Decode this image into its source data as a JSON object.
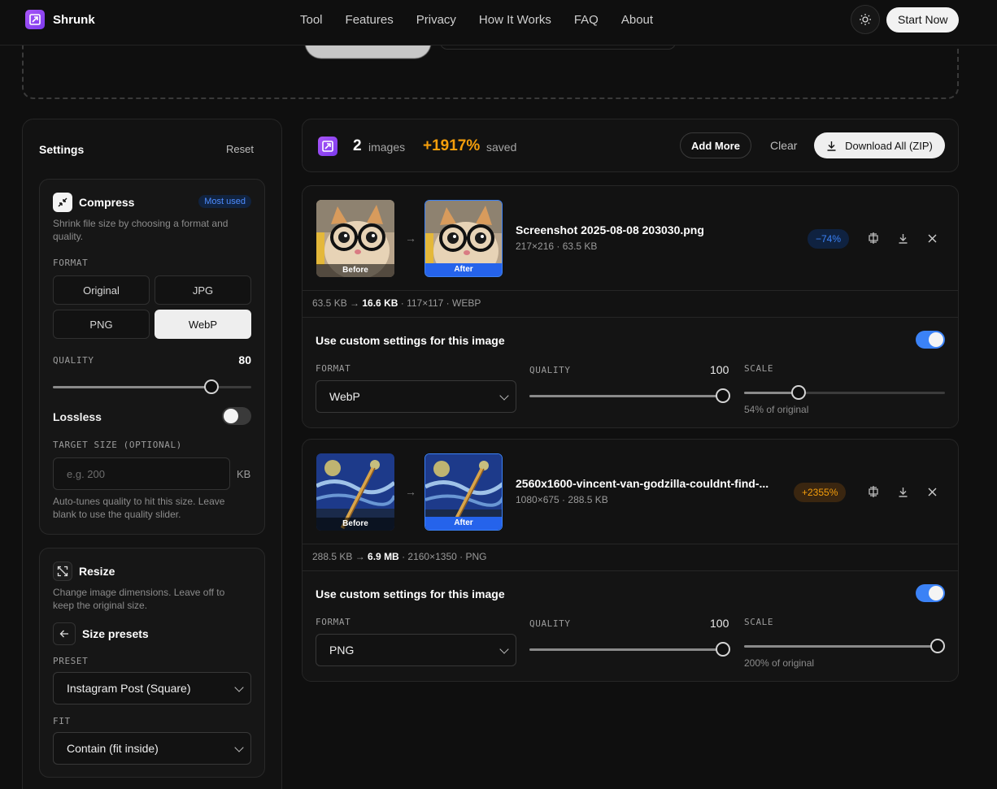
{
  "brand": {
    "name": "Shrunk"
  },
  "nav": {
    "links": [
      "Tool",
      "Features",
      "Privacy",
      "How It Works",
      "FAQ",
      "About"
    ],
    "cta": "Start Now"
  },
  "settings": {
    "title": "Settings",
    "reset": "Reset",
    "compress": {
      "title": "Compress",
      "badge": "Most used",
      "description": "Shrink file size by choosing a format and quality.",
      "format_label": "FORMAT",
      "formats": [
        "Original",
        "JPG",
        "PNG",
        "WebP"
      ],
      "selected_format": "WebP",
      "quality_label": "QUALITY",
      "quality": "80",
      "quality_fraction": 0.8,
      "lossless_label": "Lossless",
      "lossless": false,
      "target_label": "TARGET SIZE (OPTIONAL)",
      "target_placeholder": "e.g. 200",
      "target_unit": "KB",
      "target_hint": "Auto-tunes quality to hit this size. Leave blank to use the quality slider."
    },
    "resize": {
      "title": "Resize",
      "description": "Change image dimensions. Leave off to keep the original size.",
      "presets_title": "Size presets",
      "preset_label": "PRESET",
      "preset_value": "Instagram Post (Square)",
      "fit_label": "FIT",
      "fit_value": "Contain (fit inside)"
    }
  },
  "summary": {
    "count": "2",
    "count_label": "images",
    "saved": "+1917%",
    "saved_label": "saved",
    "add_more": "Add More",
    "clear": "Clear",
    "download_all": "Download All (ZIP)"
  },
  "images": [
    {
      "name": "Screenshot 2025-08-08 203030.png",
      "meta": "217×216 · 63.5 KB",
      "change": "−74%",
      "before_label": "Before",
      "after_label": "After",
      "info_from": "63.5 KB → ",
      "info_to": "16.6 KB",
      "info_rest": " · 117×117 · WEBP",
      "custom_label": "Use custom settings for this image",
      "custom_on": true,
      "format_label": "FORMAT",
      "format": "WebP",
      "quality_label": "QUALITY",
      "quality": "100",
      "quality_fraction": 1.0,
      "scale_label": "SCALE",
      "scale_note": "54% of original",
      "scale_fraction": 0.27
    },
    {
      "name": "2560x1600-vincent-van-godzilla-couldnt-find-...",
      "meta": "1080×675 · 288.5 KB",
      "change": "+2355%",
      "before_label": "Before",
      "after_label": "After",
      "info_from": "288.5 KB → ",
      "info_to": "6.9 MB",
      "info_rest": " · 2160×1350 · PNG",
      "custom_label": "Use custom settings for this image",
      "custom_on": true,
      "format_label": "FORMAT",
      "format": "PNG",
      "quality_label": "QUALITY",
      "quality": "100",
      "quality_fraction": 1.0,
      "scale_label": "SCALE",
      "scale_note": "200% of original",
      "scale_fraction": 1.0
    }
  ],
  "colors": {
    "accent_blue": "#3b82f6",
    "accent_orange": "#f59e0b",
    "brand_purple": "#a855f7"
  },
  "icons": [
    "logo-icon",
    "sun-icon",
    "compress-icon",
    "resize-icon",
    "arrow-left-icon",
    "download-icon",
    "compare-icon",
    "close-icon",
    "arrow-right-icon"
  ]
}
